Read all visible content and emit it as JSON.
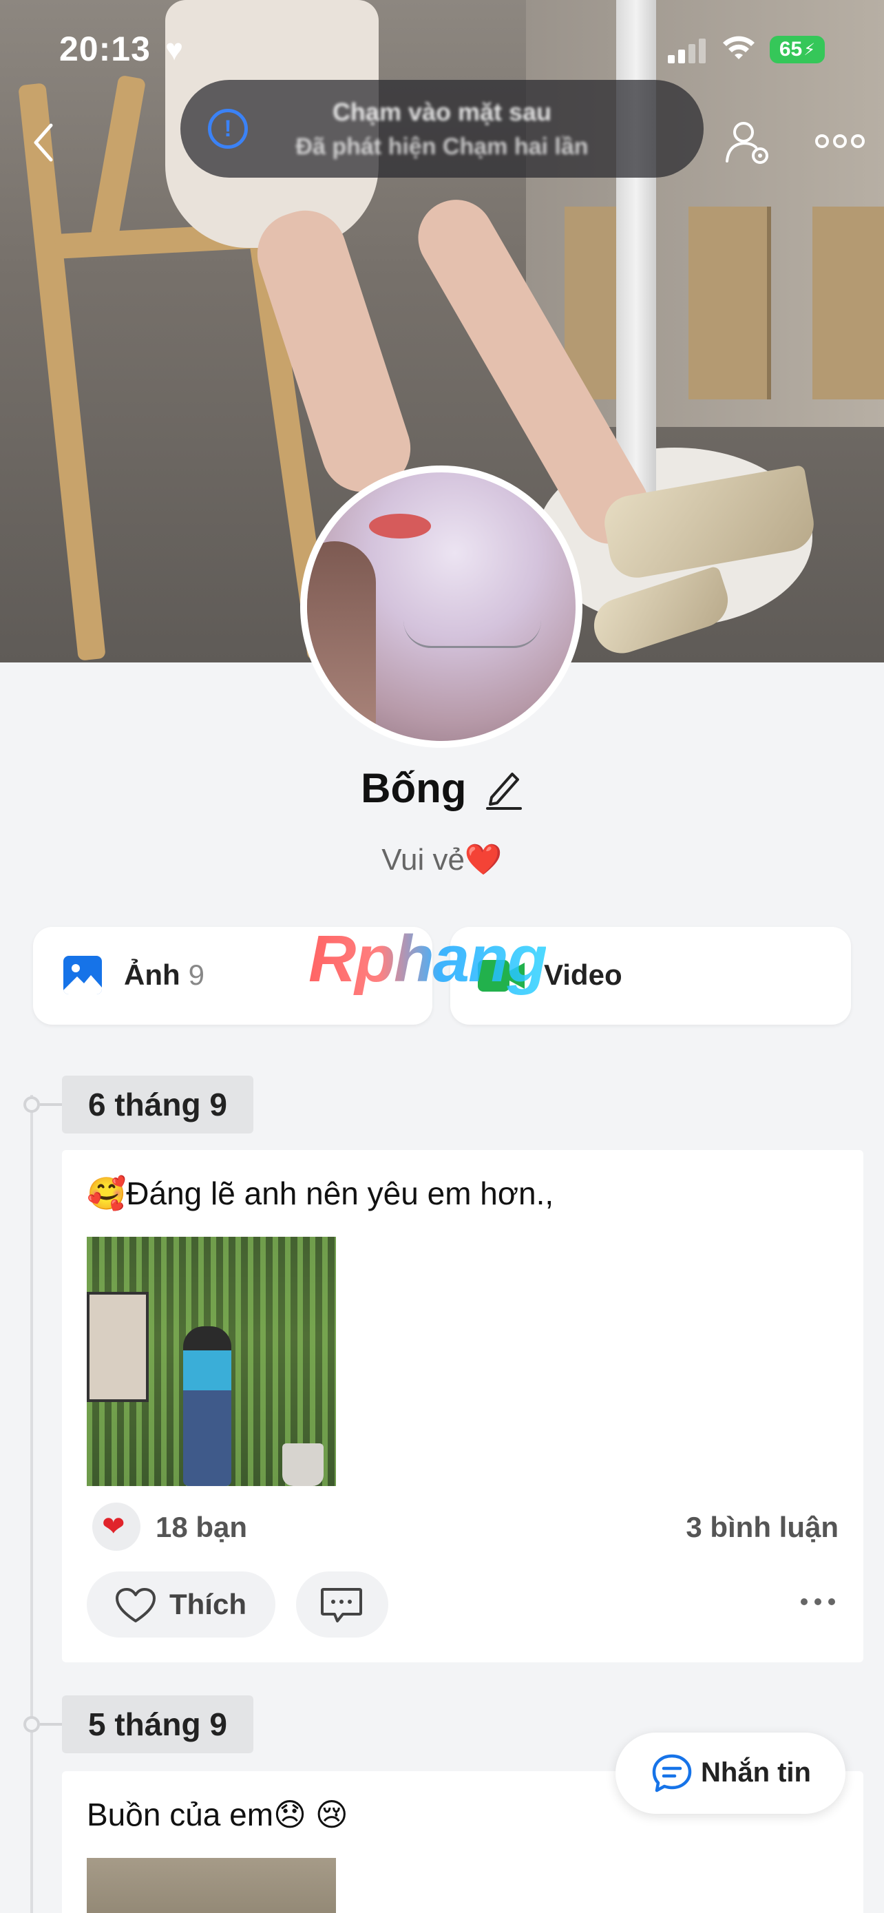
{
  "status_bar": {
    "time": "20:13",
    "battery": "65"
  },
  "toast": {
    "title": "Chạm vào mặt sau",
    "subtitle": "Đã phát hiện Chạm hai lần"
  },
  "profile": {
    "name": "Bống",
    "bio": "Vui vẻ",
    "bio_emoji": "❤️"
  },
  "albums": {
    "photos": {
      "label": "Ảnh",
      "count": "9"
    },
    "videos": {
      "label": "Video"
    }
  },
  "watermark": "Rphang",
  "posts": [
    {
      "date": "6 tháng 9",
      "caption": "🥰Đáng lẽ anh nên yêu em hơn.,",
      "reaction_emoji": "❤",
      "reactions": "18 bạn",
      "comments": "3 bình luận",
      "like_label": "Thích"
    },
    {
      "date": "5 tháng 9",
      "caption": "Buồn của em😞 😢"
    }
  ],
  "fab": {
    "label": "Nhắn tin"
  },
  "colors": {
    "accent": "#1673e8",
    "like_red": "#e0242b",
    "battery_green": "#35c759",
    "video_green": "#22b14c"
  }
}
